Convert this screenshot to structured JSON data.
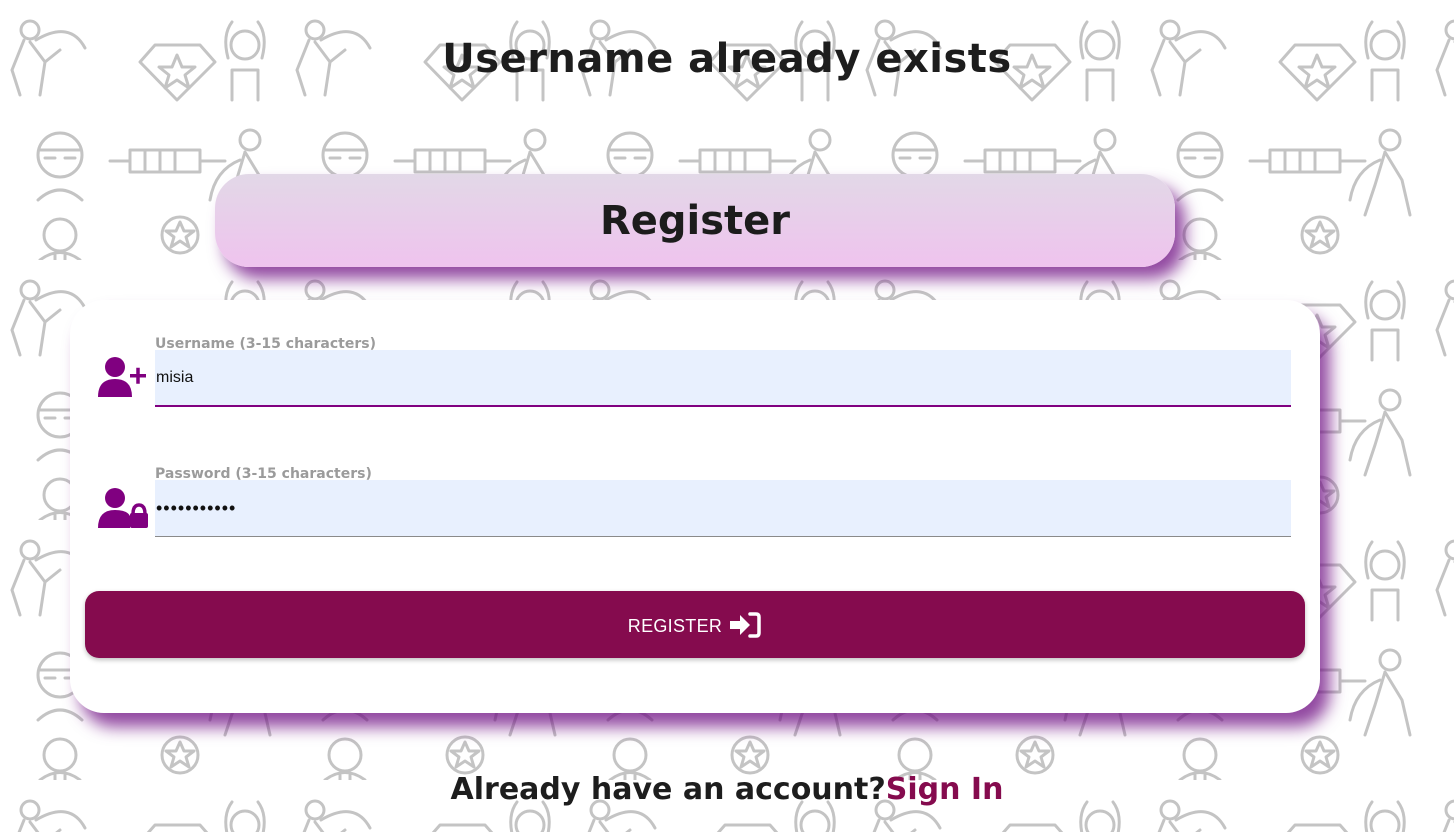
{
  "page": {
    "error_message": "Username already exists",
    "title": "Register"
  },
  "form": {
    "username": {
      "label": "Username (3-15 characters)",
      "value": "misia",
      "icon": "user-plus-icon"
    },
    "password": {
      "label": "Password (3-15 characters)",
      "value": "gwiazdka123",
      "icon": "user-lock-icon"
    },
    "submit": {
      "label": "REGISTER",
      "icon": "sign-in-icon"
    }
  },
  "footer": {
    "prompt": "Already have an account?",
    "link_label": "Sign In"
  },
  "colors": {
    "accent": "#800080",
    "button": "#850b4e",
    "input_bg": "#e8f0fe",
    "header_gradient_top": "#e2d8e7",
    "header_gradient_bottom": "#efc3ee",
    "shadow": "#6e0c82"
  }
}
